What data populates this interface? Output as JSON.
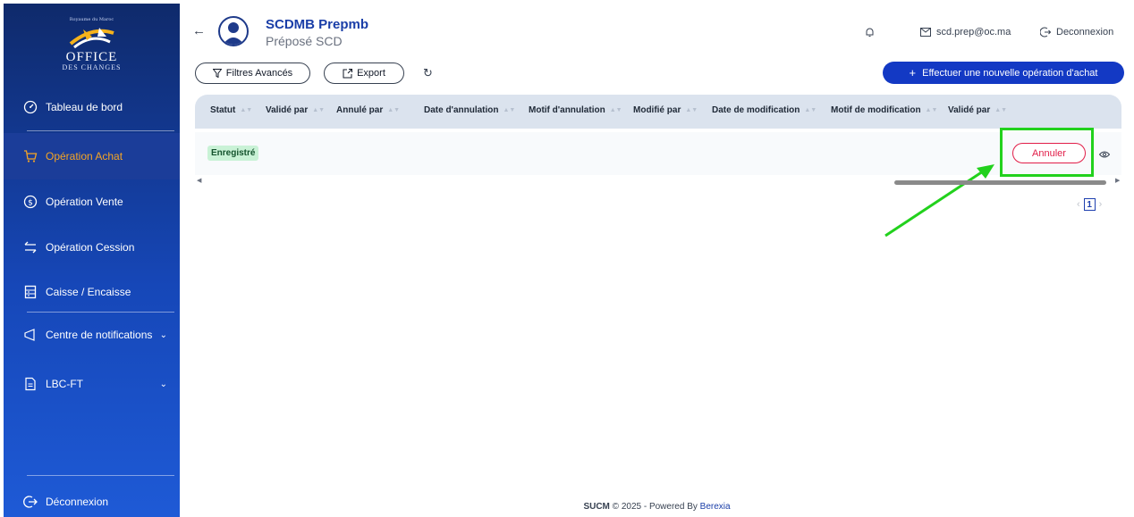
{
  "logo": {
    "kingdom": "Royaume du Maroc",
    "office": "OFFICE",
    "changes": "DES CHANGES"
  },
  "sidebar": {
    "items": [
      {
        "label": "Tableau de bord",
        "icon": "gauge-icon"
      },
      {
        "label": "Opération Achat",
        "icon": "cart-icon",
        "active": true
      },
      {
        "label": "Opération Vente",
        "icon": "dollar-icon"
      },
      {
        "label": "Opération Cession",
        "icon": "swap-icon"
      },
      {
        "label": "Caisse / Encaisse",
        "icon": "cash-register-icon"
      },
      {
        "label": "Centre de notifications",
        "icon": "megaphone-icon"
      },
      {
        "label": "LBC-FT",
        "icon": "document-icon"
      }
    ],
    "logout": "Déconnexion"
  },
  "header": {
    "user_name": "SCDMB Prepmb",
    "user_role": "Préposé SCD",
    "email": "scd.prep@oc.ma",
    "logout": "Deconnexion"
  },
  "toolbar": {
    "filters": "Filtres Avancés",
    "export": "Export",
    "new_operation": "Effectuer une nouvelle opération d'achat"
  },
  "table": {
    "columns": [
      "Statut",
      "Validé par",
      "Annulé par",
      "Date d'annulation",
      "Motif d'annulation",
      "Modifié par",
      "Date de modification",
      "Motif de modification",
      "Validé par"
    ],
    "rows": [
      {
        "status": "Enregistré",
        "action": "Annuler"
      }
    ]
  },
  "pagination": {
    "current": "1"
  },
  "footer": {
    "brand": "SUCM",
    "text": "© 2025 - Powered By",
    "company": "Berexia"
  },
  "colors": {
    "primary": "#1339c4",
    "accent": "#f5a524",
    "danger": "#e11d48",
    "highlight": "#22d11d"
  }
}
